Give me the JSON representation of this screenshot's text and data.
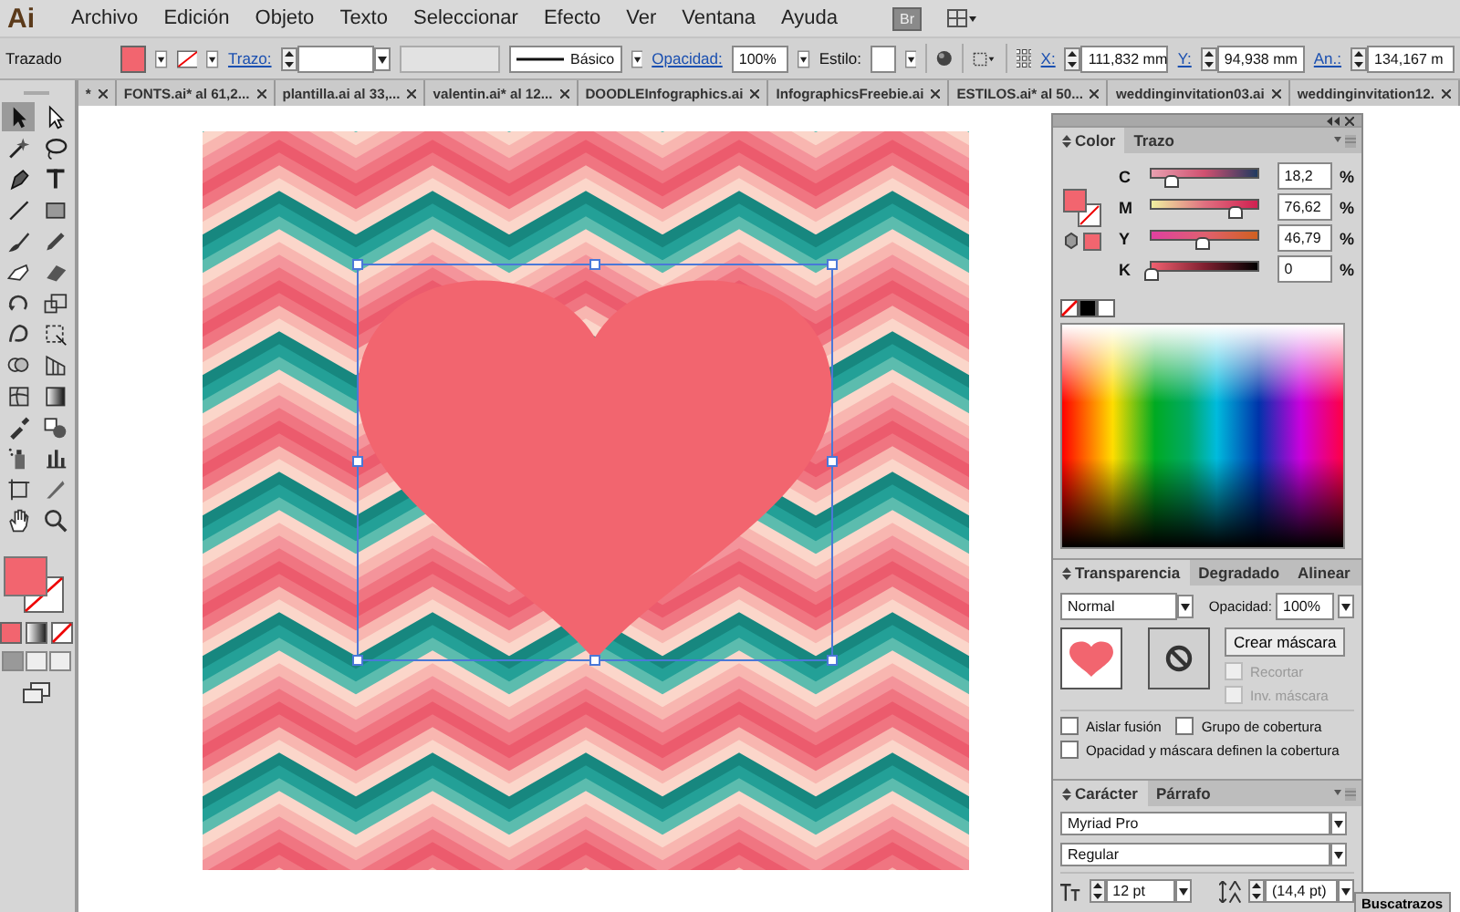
{
  "app": {
    "logo": "Ai",
    "bridge": "Br"
  },
  "menu": [
    "Archivo",
    "Edición",
    "Objeto",
    "Texto",
    "Seleccionar",
    "Efecto",
    "Ver",
    "Ventana",
    "Ayuda"
  ],
  "control_bar": {
    "selection_label": "Trazado",
    "stroke_link": "Trazo:",
    "stroke_profile": "Básico",
    "opacity_label": "Opacidad:",
    "opacity": "100%",
    "style_label": "Estilo:",
    "x_label": "X:",
    "x": "111,832 mm",
    "y_label": "Y:",
    "y": "94,938 mm",
    "width_label": "An.:",
    "width": "134,167 m"
  },
  "toolbar": {
    "tools": [
      {
        "kind": "select",
        "selected": true
      },
      {
        "kind": "direct-select",
        "selected": false
      },
      {
        "kind": "magic-wand",
        "selected": false
      },
      {
        "kind": "lasso",
        "selected": false
      },
      {
        "kind": "pen",
        "selected": false
      },
      {
        "kind": "type",
        "selected": false
      },
      {
        "kind": "line",
        "selected": false
      },
      {
        "kind": "rect",
        "selected": false
      },
      {
        "kind": "brush",
        "selected": false
      },
      {
        "kind": "pencil",
        "selected": false
      },
      {
        "kind": "blob-brush",
        "selected": false
      },
      {
        "kind": "eraser",
        "selected": false
      },
      {
        "kind": "rotate",
        "selected": false
      },
      {
        "kind": "scale",
        "selected": false
      },
      {
        "kind": "warp",
        "selected": false
      },
      {
        "kind": "free-transform",
        "selected": false
      },
      {
        "kind": "shape-builder",
        "selected": false
      },
      {
        "kind": "perspective",
        "selected": false
      },
      {
        "kind": "mesh",
        "selected": false
      },
      {
        "kind": "gradient",
        "selected": false
      },
      {
        "kind": "eyedropper",
        "selected": false
      },
      {
        "kind": "blend",
        "selected": false
      },
      {
        "kind": "symbol-sprayer",
        "selected": false
      },
      {
        "kind": "graph",
        "selected": false
      },
      {
        "kind": "artboard",
        "selected": false
      },
      {
        "kind": "slice",
        "selected": false
      },
      {
        "kind": "hand",
        "selected": false
      },
      {
        "kind": "zoom",
        "selected": false
      }
    ]
  },
  "tabs": [
    {
      "label": "*",
      "selected": false
    },
    {
      "label": "FONTS.ai* al 61,2...",
      "selected": false
    },
    {
      "label": "plantilla.ai al 33,...",
      "selected": false
    },
    {
      "label": "valentin.ai* al 12...",
      "selected": false
    },
    {
      "label": "DOODLEInfographics.ai",
      "selected": false
    },
    {
      "label": "InfographicsFreebie.ai",
      "selected": false
    },
    {
      "label": "ESTILOS.ai* al 50...",
      "selected": false
    },
    {
      "label": "weddinginvitation03.ai",
      "selected": false
    },
    {
      "label": "weddinginvitation12.",
      "selected": false
    }
  ],
  "color_panel": {
    "tabs": [
      {
        "label": "Color",
        "selected": true
      },
      {
        "label": "Trazo",
        "selected": false
      }
    ],
    "sliders": [
      {
        "label": "C",
        "value": "18,2",
        "unit": "%",
        "level": 0.182
      },
      {
        "label": "M",
        "value": "76,62",
        "unit": "%",
        "level": 0.7662
      },
      {
        "label": "Y",
        "value": "46,79",
        "unit": "%",
        "level": 0.4679
      },
      {
        "label": "K",
        "value": "0",
        "unit": "%",
        "level": 0
      }
    ]
  },
  "transparency_panel": {
    "tabs": [
      {
        "label": "Transparencia",
        "selected": true
      },
      {
        "label": "Degradado",
        "selected": false
      },
      {
        "label": "Alinear",
        "selected": false
      }
    ],
    "blend_mode": "Normal",
    "opacity_label": "Opacidad:",
    "opacity": "100%",
    "make_mask": "Crear máscara",
    "mask_options": [
      {
        "label": "Recortar",
        "checked": false,
        "disabled": true
      },
      {
        "label": "Inv. máscara",
        "checked": false,
        "disabled": true
      }
    ],
    "checkboxes": [
      {
        "label": "Aislar fusión",
        "checked": false
      },
      {
        "label": "Grupo de cobertura",
        "checked": false
      },
      {
        "label": "Opacidad y máscara definen la cobertura",
        "checked": false
      }
    ]
  },
  "character_panel": {
    "tabs": [
      {
        "label": "Carácter",
        "selected": true
      },
      {
        "label": "Párrafo",
        "selected": false
      }
    ],
    "font": "Myriad Pro",
    "style": "Regular",
    "size": "12 pt",
    "leading": "(14,4 pt)"
  },
  "docked_tab": "Buscatrazos"
}
